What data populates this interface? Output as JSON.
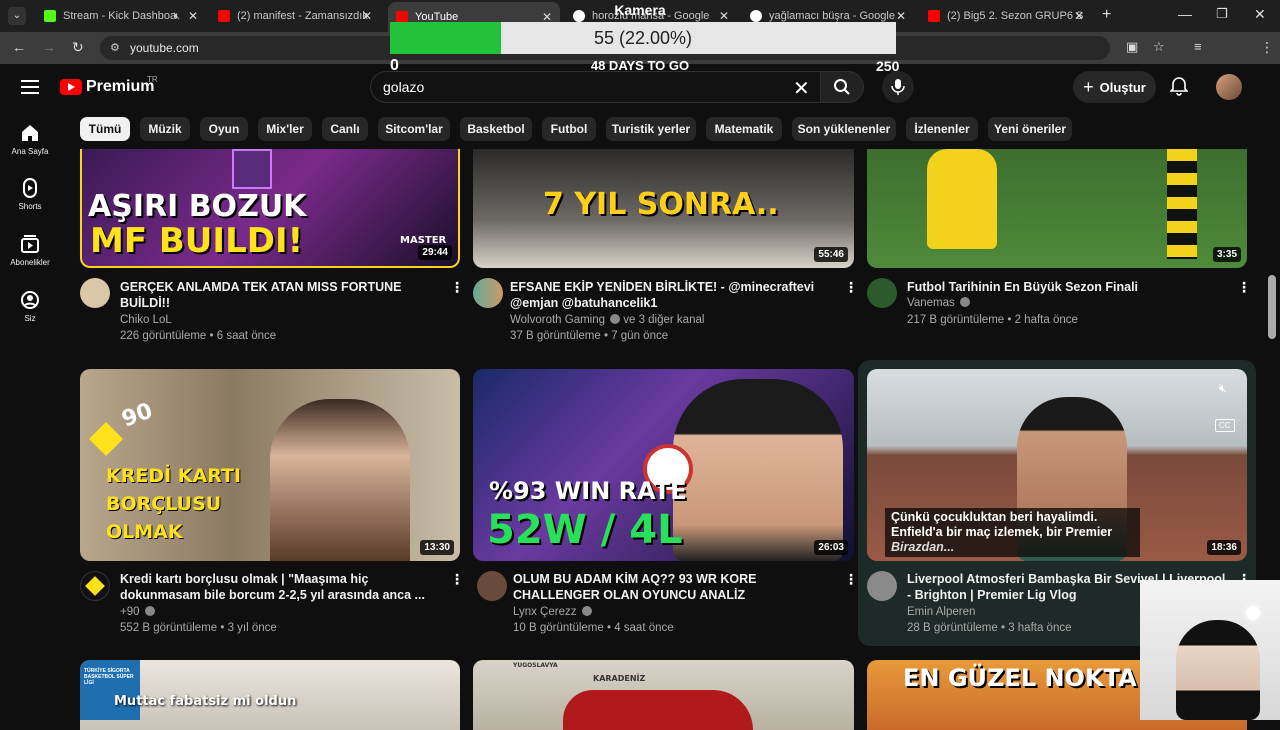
{
  "browser": {
    "tabs": [
      {
        "label": "Stream - Kick Dashboa",
        "color": "#53fc18"
      },
      {
        "label": "(2) manifest - Zamansızdık",
        "color": "#ff0000"
      },
      {
        "label": "YouTube",
        "color": "#ff0000"
      },
      {
        "label": "horozlu mahsa - Google",
        "color": "#4285f4"
      },
      {
        "label": "yağlamacı büşra - Google",
        "color": "#4285f4"
      },
      {
        "label": "(2) Big5 2. Sezon GRUP6 S",
        "color": "#ff0000"
      }
    ],
    "url": "youtube.com"
  },
  "overlay": {
    "title": "Kamera",
    "progress_text": "55 (22.00%)",
    "progress_fraction": 0.22,
    "min": "0",
    "max": "250",
    "days": "48 DAYS TO GO"
  },
  "header": {
    "logo": "Premium",
    "region": "TR",
    "search_value": "golazo",
    "create_label": "Oluştur"
  },
  "sidebar": [
    {
      "label": "Ana Sayfa",
      "icon": "home-icon"
    },
    {
      "label": "Shorts",
      "icon": "shorts-icon"
    },
    {
      "label": "Abonelikler",
      "icon": "subscriptions-icon"
    },
    {
      "label": "Siz",
      "icon": "you-icon"
    }
  ],
  "chips": [
    "Tümü",
    "Müzik",
    "Oyun",
    "Mix'ler",
    "Canlı",
    "Sitcom'lar",
    "Basketbol",
    "Futbol",
    "Turistik yerler",
    "Matematik",
    "Son yüklenenler",
    "İzlenenler",
    "Yeni öneriler"
  ],
  "videos": [
    {
      "title1": "GERÇEK ANLAMDA TEK ATAN MISS FORTUNE",
      "title2": "BUİLDİ!!",
      "channel": "Chiko LoL",
      "verified": false,
      "meta": "226 görüntüleme • 6 saat önce",
      "duration": "29:44",
      "thumb_text1": "AŞIRI BOZUK",
      "thumb_text2": "MF BUILDI!",
      "thumb_text3": "MASTER"
    },
    {
      "title1": "EFSANE EKİP YENİDEN BİRLİKTE! - @minecraftevi",
      "title2": "@emjan @batuhancelik1",
      "channel": "Wolvoroth Gaming",
      "verified": true,
      "channel_suffix": "ve 3 diğer kanal",
      "meta": "37 B görüntüleme • 7 gün önce",
      "duration": "55:46",
      "thumb_text1": "7 YIL SONRA.."
    },
    {
      "title1": "Futbol Tarihinin En Büyük Sezon Finali",
      "title2": "",
      "channel": "Vanemas",
      "verified": true,
      "meta": "217 B görüntüleme • 2 hafta önce",
      "duration": "3:35"
    },
    {
      "title1": "Kredi kartı borçlusu olmak | \"Maaşıma hiç",
      "title2": "dokunmasam bile borcum 2-2,5 yıl arasında anca ...",
      "channel": "+90",
      "verified": true,
      "meta": "552 B görüntüleme • 3 yıl önce",
      "duration": "13:30",
      "thumb_text1": "KREDİ KARTI",
      "thumb_text2": "BORÇLUSU",
      "thumb_text3": "OLMAK",
      "thumb_badge": "90"
    },
    {
      "title1": "OLUM BU ADAM KİM AQ?? 93 WR KORE",
      "title2": "CHALLENGER OLAN OYUNCU ANALİZ",
      "channel": "Lynx Çerezz",
      "verified": true,
      "meta": "10 B görüntüleme • 4 saat önce",
      "duration": "26:03",
      "thumb_text1": "%93 WIN RATE",
      "thumb_text2": "52W / 4L"
    },
    {
      "title1": "Liverpool Atmosferi Bambaşka Bir Seviye! | Liverpool",
      "title2": "- Brighton | Premier Lig Vlog",
      "channel": "Emin Alperen",
      "verified": false,
      "meta": "28 B görüntüleme • 3 hafta önce",
      "duration": "18:36",
      "caption1": "Çünkü çocukluktan beri hayalimdi.",
      "caption2": "Enfield'a bir maç izlemek, bir Premier",
      "caption3": "Birazdan...",
      "cc": "CC"
    }
  ],
  "bottom_row": [
    {
      "thumb_text1": "Muttac fabatsiz mi oldun",
      "label_top": "TÜRKİYE SİGORTA BASKETBOL SÜPER LİGİ"
    },
    {
      "thumb_text1": "KARADENİZ",
      "label_top": "YUGOSLAVYA"
    },
    {
      "thumb_text1": "EN GÜZEL NOKTA"
    }
  ]
}
